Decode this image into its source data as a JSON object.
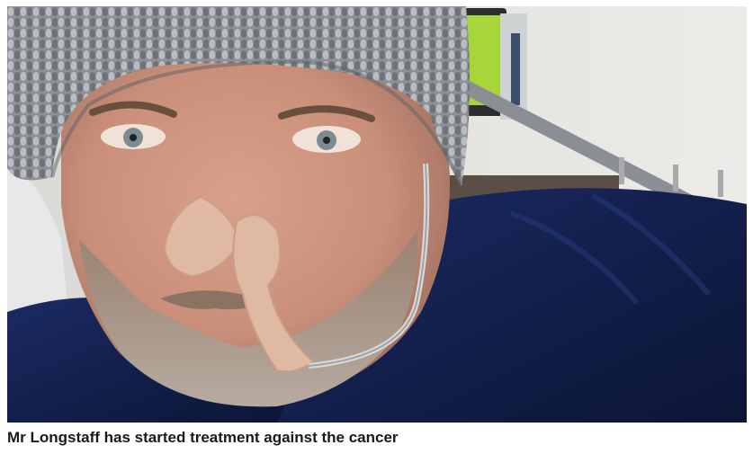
{
  "figure": {
    "image": {
      "description_icon": "hospital-selfie-photo"
    },
    "caption": "Mr Longstaff has started treatment against the cancer"
  }
}
